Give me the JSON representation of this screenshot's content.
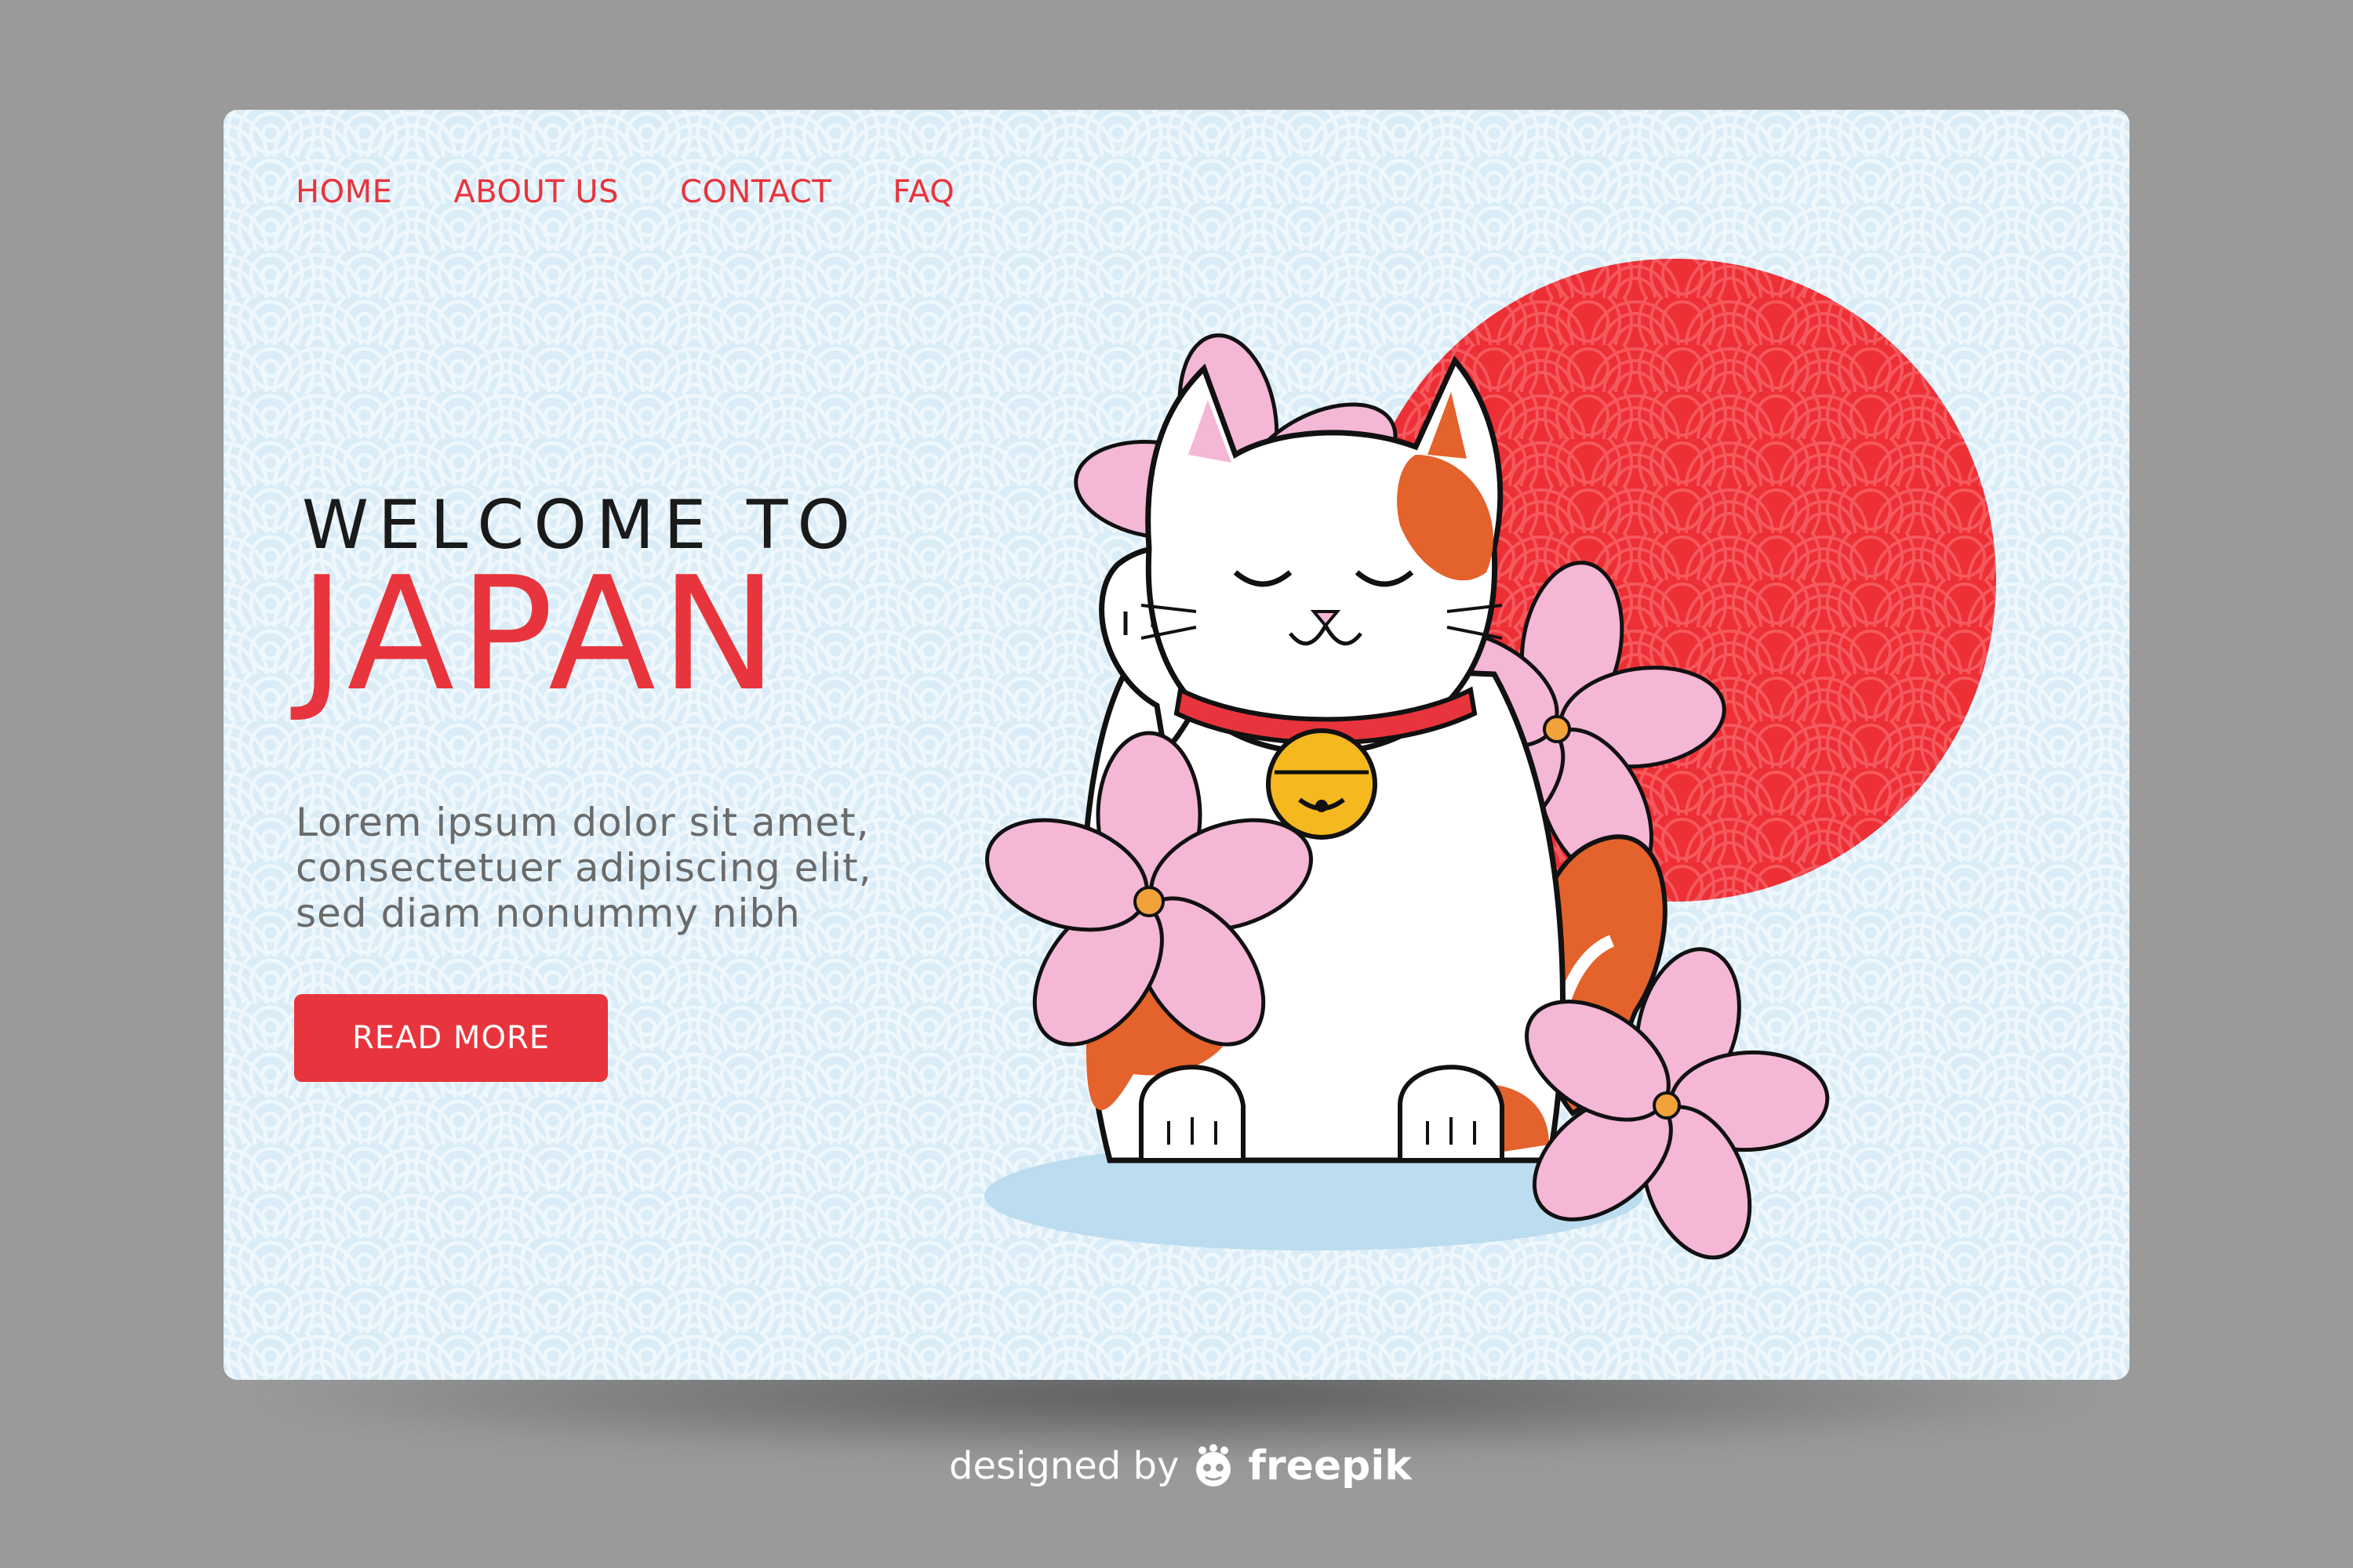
{
  "nav": {
    "items": [
      {
        "label": "HOME"
      },
      {
        "label": "ABOUT US"
      },
      {
        "label": "CONTACT"
      },
      {
        "label": "FAQ"
      }
    ]
  },
  "hero": {
    "welcome": "WELCOME TO",
    "title": "JAPAN",
    "body": "Lorem ipsum dolor sit amet,\nconsectetuer adipiscing elit,\nsed diam nonummy nibh",
    "button_label": "READ MORE"
  },
  "illustration": {
    "subject": "maneki-neko-cat",
    "elements": [
      "red-sun-circle",
      "maneki-neko-cat",
      "cherry-blossom-flowers",
      "golden-bell"
    ]
  },
  "footer": {
    "designed_by": "designed by",
    "brand": "freepik"
  },
  "colors": {
    "accent_red": "#e8343c",
    "background_light_blue": "#d9ecf7",
    "page_gray": "#9a9a9a",
    "blossom_pink": "#f4b7d6",
    "cat_orange": "#e4622b",
    "bell_gold": "#f5b81f"
  }
}
